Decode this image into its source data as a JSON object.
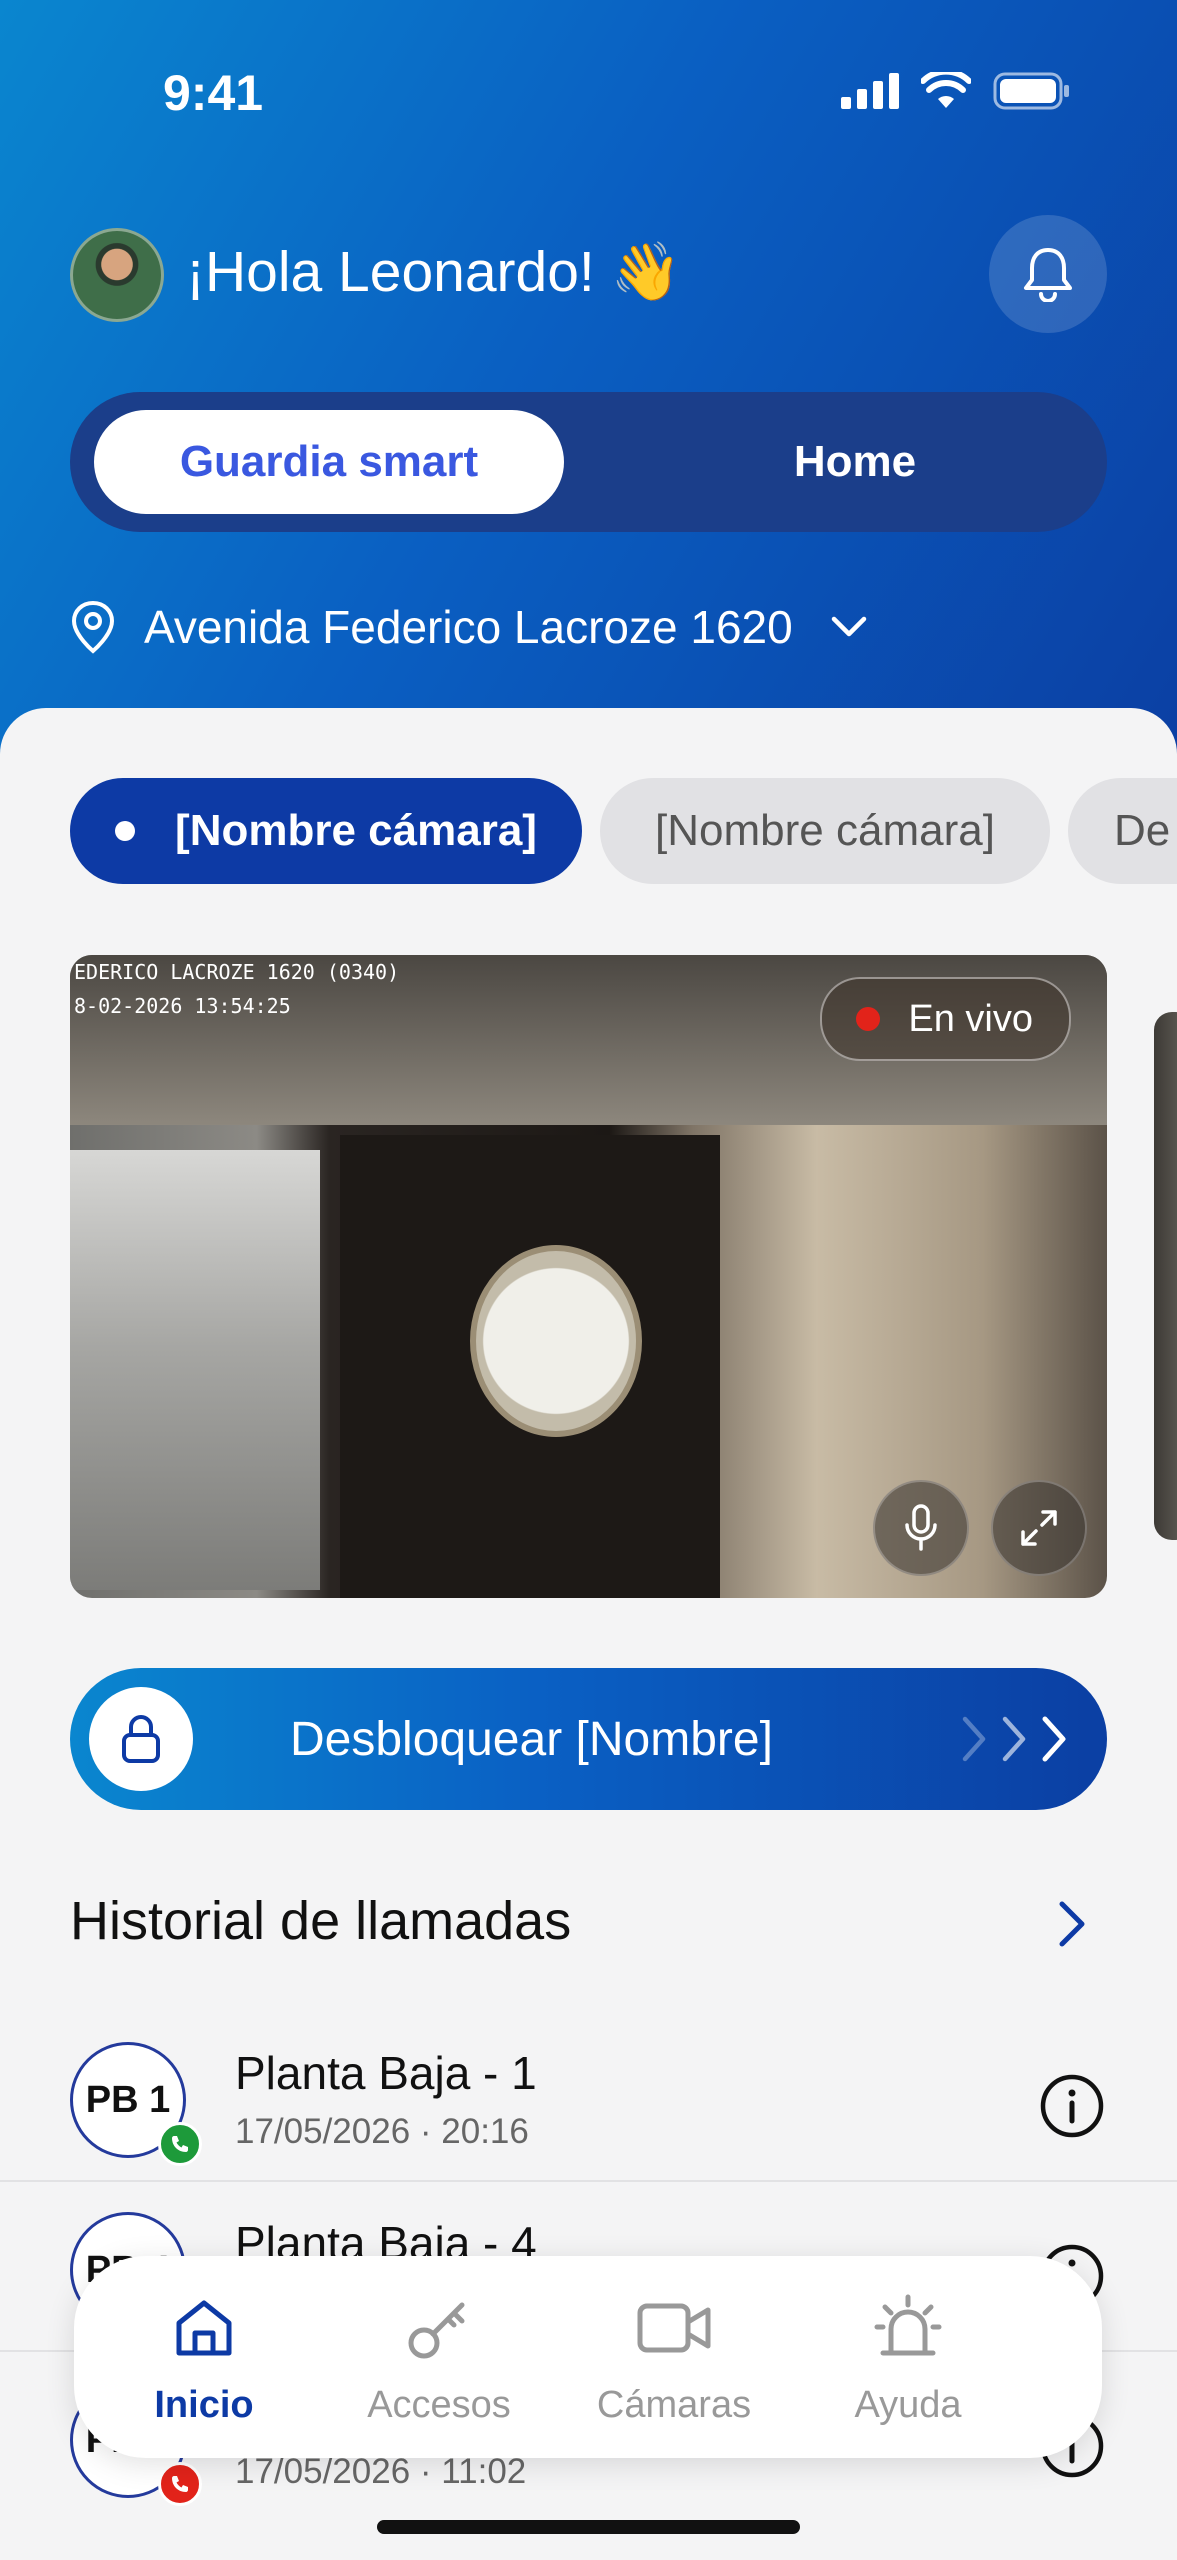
{
  "status_bar": {
    "time": "9:41"
  },
  "header": {
    "greeting": "¡Hola Leonardo! 👋",
    "segment": {
      "active": "Guardia smart",
      "inactive": "Home"
    },
    "location": "Avenida Federico Lacroze 1620"
  },
  "camera_chips": [
    "[Nombre cámara]",
    "[Nombre cámara]",
    "De"
  ],
  "camera": {
    "overlay_line1": "EDERICO LACROZE 1620 (0340)",
    "overlay_line2": "8-02-2026 13:54:25",
    "live_label": "En vivo"
  },
  "unlock": {
    "label": "Desbloquear [Nombre]"
  },
  "history": {
    "title": "Historial de llamadas",
    "items": [
      {
        "badge": "PB 1",
        "title": "Planta Baja - 1",
        "time": "17/05/2026 · 20:16",
        "status": "answered"
      },
      {
        "badge": "PB 4",
        "title": "Planta Baja - 4",
        "time": "",
        "status": "answered"
      },
      {
        "badge": "PB 2",
        "title": "",
        "time": "17/05/2026 · 11:02",
        "status": "missed"
      }
    ]
  },
  "tabbar": {
    "tabs": [
      {
        "label": "Inicio",
        "active": true
      },
      {
        "label": "Accesos",
        "active": false
      },
      {
        "label": "Cámaras",
        "active": false
      },
      {
        "label": "Ayuda",
        "active": false
      }
    ]
  },
  "colors": {
    "primary": "#0d3aa5",
    "accent": "#3a58e0",
    "answered": "#1d9a3a",
    "missed": "#e2231a"
  }
}
